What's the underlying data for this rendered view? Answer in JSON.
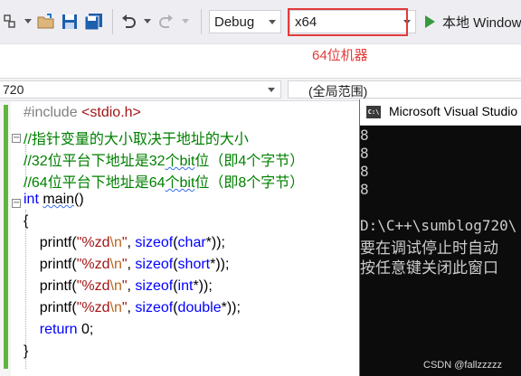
{
  "toolbar": {
    "config": "Debug",
    "platform": "x64",
    "annotation": "64位机器",
    "run_label": "本地 Windows"
  },
  "navbar": {
    "scope": "720",
    "member": "(全局范围)"
  },
  "editor": {
    "lines": [
      {
        "id": "include",
        "parts": [
          {
            "t": "#include ",
            "c": "pp"
          },
          {
            "t": "<stdio.h>",
            "c": "str"
          }
        ]
      },
      {
        "id": "c1",
        "parts": [
          {
            "t": "//指针变量的大小取决于地址的大小",
            "c": "cmt"
          }
        ]
      },
      {
        "id": "c2",
        "parts": [
          {
            "t": "//32位平台下地址是32",
            "c": "cmt"
          },
          {
            "t": "个bit",
            "c": "cmt squig"
          },
          {
            "t": "位（即4个字节）",
            "c": "cmt"
          }
        ]
      },
      {
        "id": "c3",
        "parts": [
          {
            "t": "//64位平台下地址是64",
            "c": "cmt"
          },
          {
            "t": "个bit",
            "c": "cmt squig"
          },
          {
            "t": "位（即8个字节）",
            "c": "cmt"
          }
        ]
      },
      {
        "id": "main",
        "parts": [
          {
            "t": "int ",
            "c": "kw"
          },
          {
            "t": "main",
            "c": "fn squig"
          },
          {
            "t": "()",
            "c": ""
          }
        ]
      },
      {
        "id": "open",
        "parts": [
          {
            "t": "{",
            "c": ""
          }
        ]
      },
      {
        "id": "p1",
        "parts": [
          {
            "t": "    printf(",
            "c": ""
          },
          {
            "t": "\"%zd",
            "c": "str"
          },
          {
            "t": "\\n",
            "c": "esc"
          },
          {
            "t": "\"",
            "c": "str"
          },
          {
            "t": ", ",
            "c": ""
          },
          {
            "t": "sizeof",
            "c": "kw"
          },
          {
            "t": "(",
            "c": ""
          },
          {
            "t": "char",
            "c": "kw"
          },
          {
            "t": "*));",
            "c": ""
          }
        ]
      },
      {
        "id": "p2",
        "parts": [
          {
            "t": "    printf(",
            "c": ""
          },
          {
            "t": "\"%zd",
            "c": "str"
          },
          {
            "t": "\\n",
            "c": "esc"
          },
          {
            "t": "\"",
            "c": "str"
          },
          {
            "t": ", ",
            "c": ""
          },
          {
            "t": "sizeof",
            "c": "kw"
          },
          {
            "t": "(",
            "c": ""
          },
          {
            "t": "short",
            "c": "kw"
          },
          {
            "t": "*));",
            "c": ""
          }
        ]
      },
      {
        "id": "p3",
        "parts": [
          {
            "t": "    printf(",
            "c": ""
          },
          {
            "t": "\"%zd",
            "c": "str"
          },
          {
            "t": "\\n",
            "c": "esc"
          },
          {
            "t": "\"",
            "c": "str"
          },
          {
            "t": ", ",
            "c": ""
          },
          {
            "t": "sizeof",
            "c": "kw"
          },
          {
            "t": "(",
            "c": ""
          },
          {
            "t": "int",
            "c": "kw"
          },
          {
            "t": "*));",
            "c": ""
          }
        ]
      },
      {
        "id": "p4",
        "parts": [
          {
            "t": "    printf(",
            "c": ""
          },
          {
            "t": "\"%zd",
            "c": "str"
          },
          {
            "t": "\\n",
            "c": "esc"
          },
          {
            "t": "\"",
            "c": "str"
          },
          {
            "t": ", ",
            "c": ""
          },
          {
            "t": "sizeof",
            "c": "kw"
          },
          {
            "t": "(",
            "c": ""
          },
          {
            "t": "double",
            "c": "kw"
          },
          {
            "t": "*));",
            "c": ""
          }
        ]
      },
      {
        "id": "ret",
        "parts": [
          {
            "t": "    ",
            "c": ""
          },
          {
            "t": "return",
            "c": "kw"
          },
          {
            "t": " 0;",
            "c": ""
          }
        ]
      },
      {
        "id": "close",
        "parts": [
          {
            "t": "}",
            "c": ""
          }
        ]
      }
    ]
  },
  "console": {
    "title": "Microsoft Visual Studio",
    "lines": [
      "8",
      "8",
      "8",
      "8",
      "",
      "D:\\C++\\sumblog720\\",
      "要在调试停止时自动",
      "按任意键关闭此窗口"
    ]
  },
  "watermark": "CSDN @fallzzzzz",
  "icons": [
    "nav-icon",
    "open-folder-icon",
    "save-icon",
    "save-all-icon",
    "undo-icon",
    "redo-icon",
    "run-icon",
    "console-app-icon"
  ]
}
